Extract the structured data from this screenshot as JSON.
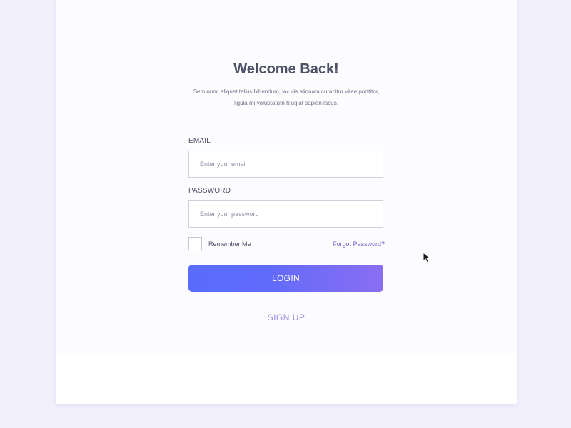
{
  "login": {
    "title": "Welcome Back!",
    "subtitle": "Sem nunc aliquet tellus bibendum, iaculis aliquam curabitur vitae porttitor, ligula mi voluptatum feugiat sapien lacus.",
    "email": {
      "label": "EMAIL",
      "placeholder": "Enter your email",
      "value": ""
    },
    "password": {
      "label": "PASSWORD",
      "placeholder": "Enter your password",
      "value": ""
    },
    "remember_me": {
      "label": "Remember Me",
      "checked": false
    },
    "forgot_password": "Forgot Password?",
    "login_button": "LOGIN",
    "signup_link": "SIGN UP"
  },
  "colors": {
    "background": "#f1f0fb",
    "card": "#ffffff",
    "text": "#4e5066",
    "accent_start": "#5a6cfd",
    "accent_end": "#8a6ef2",
    "link": "#6f64d2",
    "signup": "#9b8ee0"
  },
  "icons": {
    "cursor": "mouse-pointer-icon"
  }
}
